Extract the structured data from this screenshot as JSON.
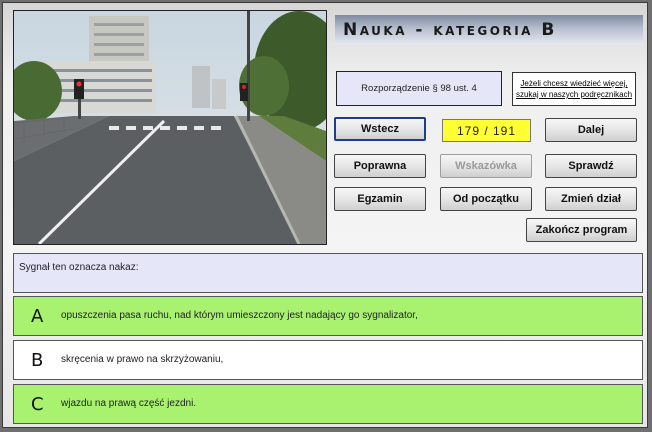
{
  "title": "Nauka - kategoria B",
  "regulation": "Rozporządzenie § 98 ust. 4",
  "more_info_link": "Jeżeli chcesz wiedzieć więcej, szukaj w naszych podręcznikach",
  "counter": "179 / 191",
  "buttons": {
    "back": "Wstecz",
    "next": "Dalej",
    "correct": "Poprawna",
    "hint": "Wskazówka",
    "check": "Sprawdź",
    "exam": "Egzamin",
    "restart": "Od początku",
    "change_section": "Zmień dział",
    "quit": "Zakończ program"
  },
  "question": "Sygnał ten oznacza nakaz:",
  "answers": [
    {
      "letter": "A",
      "text": "opuszczenia pasa ruchu, nad którym umieszczony jest nadający go sygnalizator,",
      "highlight": "#a8f26f"
    },
    {
      "letter": "B",
      "text": "skręcenia w prawo na skrzyżowaniu,",
      "highlight": "#ffffff"
    },
    {
      "letter": "C",
      "text": "wjazdu na prawą część jezdni.",
      "highlight": "#a8f26f"
    }
  ],
  "colors": {
    "counter_bg": "#ffff33",
    "correct_answer": "#a8f26f",
    "panel_lavender": "#e6e6f9"
  },
  "photo": {
    "alt": "road-intersection-with-traffic-signal"
  }
}
